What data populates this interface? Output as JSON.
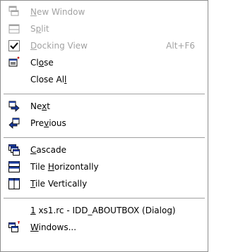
{
  "menu": {
    "items": [
      {
        "pre": "",
        "key": "N",
        "post": "ew Window",
        "shortcut": "",
        "icon": "new-window-icon",
        "disabled": true
      },
      {
        "pre": "S",
        "key": "p",
        "post": "lit",
        "shortcut": "",
        "icon": "split-icon",
        "disabled": true
      },
      {
        "pre": "",
        "key": "D",
        "post": "ocking View",
        "shortcut": "Alt+F6",
        "icon": "checkmark-icon",
        "disabled": true
      },
      {
        "pre": "Cl",
        "key": "o",
        "post": "se",
        "shortcut": "",
        "icon": "close-window-icon",
        "disabled": false
      },
      {
        "pre": "Close Al",
        "key": "l",
        "post": "",
        "shortcut": "",
        "icon": "",
        "disabled": false
      },
      {
        "pre": "Ne",
        "key": "x",
        "post": "t",
        "shortcut": "",
        "icon": "next-arrow-icon",
        "disabled": false
      },
      {
        "pre": "Pre",
        "key": "v",
        "post": "ious",
        "shortcut": "",
        "icon": "previous-arrow-icon",
        "disabled": false
      },
      {
        "pre": "",
        "key": "C",
        "post": "ascade",
        "shortcut": "",
        "icon": "cascade-icon",
        "disabled": false
      },
      {
        "pre": "Tile ",
        "key": "H",
        "post": "orizontally",
        "shortcut": "",
        "icon": "tile-horizontal-icon",
        "disabled": false
      },
      {
        "pre": "",
        "key": "T",
        "post": "ile Vertically",
        "shortcut": "",
        "icon": "tile-vertical-icon",
        "disabled": false
      },
      {
        "pre": "",
        "key": "1",
        "post": " xs1.rc - IDD_ABOUTBOX (Dialog)",
        "shortcut": "",
        "icon": "",
        "disabled": false
      },
      {
        "pre": "",
        "key": "W",
        "post": "indows...",
        "shortcut": "",
        "icon": "windows-list-icon",
        "disabled": false
      }
    ]
  },
  "colors": {
    "accent": "#1a3b9e",
    "disabled_text": "#a2a2a2",
    "text": "#000000"
  }
}
